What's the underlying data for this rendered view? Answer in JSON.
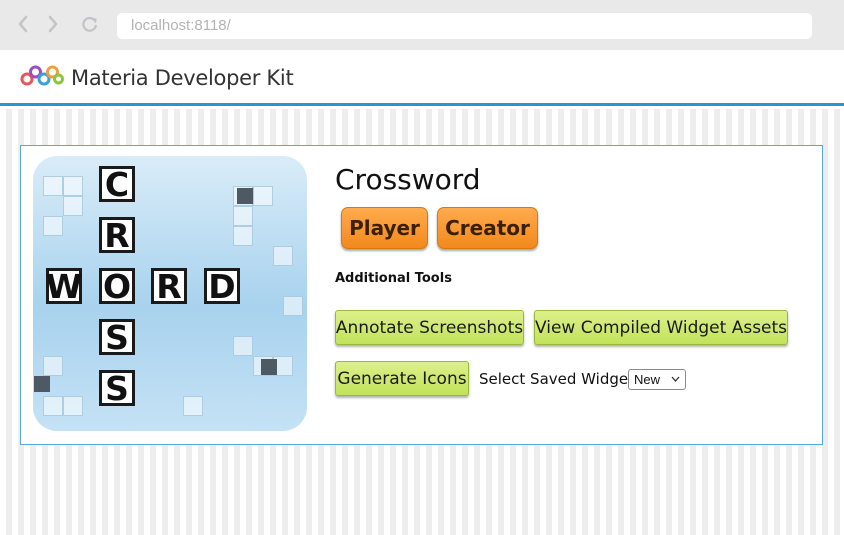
{
  "browser": {
    "url": "localhost:8118/",
    "back_icon": "chevron-left-icon",
    "forward_icon": "chevron-right-icon",
    "reload_icon": "reload-icon"
  },
  "app": {
    "title": "Materia Developer Kit",
    "logo_icon": "materia-logo-icon",
    "accent_color": "#2a93d2"
  },
  "widget": {
    "title": "Crossword",
    "image_letters": {
      "vertical": [
        "C",
        "R",
        "O",
        "S",
        "S"
      ],
      "horizontal": [
        "W",
        "O",
        "R",
        "D"
      ]
    },
    "player_label": "Player",
    "creator_label": "Creator",
    "tools_label": "Additional Tools",
    "annotate_label": "Annotate Screenshots",
    "assets_label": "View Compiled Widget Assets",
    "icons_label": "Generate Icons",
    "select_label": "Select Saved Widget:",
    "select_value": "New"
  },
  "colors": {
    "primary_button": "#f2891c",
    "tool_button": "#c2e25c",
    "card_border": "#58a8d8"
  }
}
